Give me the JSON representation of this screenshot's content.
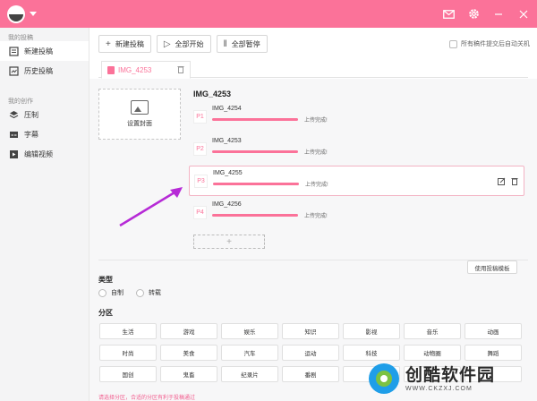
{
  "colors": {
    "accent": "#fb7299",
    "sidebar_bg": "#f4f4f5",
    "panel_bg": "#f7f7f8",
    "hint": "#f25d8e"
  },
  "titlebar": {
    "icons": [
      "app-logo",
      "mail-icon",
      "settings-icon",
      "minimize-icon",
      "close-icon"
    ]
  },
  "sidebar": {
    "group1": "我的投稿",
    "group2": "我的创作",
    "items1": [
      {
        "label": "新建投稿",
        "icon": "upload-icon",
        "active": true
      },
      {
        "label": "历史投稿",
        "icon": "history-icon",
        "active": false
      }
    ],
    "items2": [
      {
        "label": "压制",
        "icon": "layers-icon"
      },
      {
        "label": "字幕",
        "icon": "subtitle-icon"
      },
      {
        "label": "编辑视频",
        "icon": "video-edit-icon"
      }
    ]
  },
  "toolbar": {
    "new_label": "新建投稿",
    "start_all_label": "全部开始",
    "pause_all_label": "全部暂停",
    "autoshut_label": "所有稿件提交后自动关机"
  },
  "tab": {
    "name": "IMG_4253"
  },
  "cover": {
    "label": "设置封面"
  },
  "video": {
    "title": "IMG_4253"
  },
  "parts": [
    {
      "badge": "P1",
      "name": "IMG_4254",
      "status": "上传完成!",
      "progress": 1.0
    },
    {
      "badge": "P2",
      "name": "IMG_4253",
      "status": "上传完成!",
      "progress": 1.0
    },
    {
      "badge": "P3",
      "name": "IMG_4255",
      "status": "上传完成!",
      "progress": 1.0
    },
    {
      "badge": "P4",
      "name": "IMG_4256",
      "status": "上传完成!",
      "progress": 1.0
    }
  ],
  "add_part": "+",
  "template_button": "使用投稿模板",
  "type_section": {
    "title": "类型",
    "options": [
      "自制",
      "转载"
    ]
  },
  "zone_section": {
    "title": "分区",
    "items": [
      "生活",
      "游戏",
      "娱乐",
      "知识",
      "影视",
      "音乐",
      "动画",
      "时尚",
      "美食",
      "汽车",
      "运动",
      "科技",
      "动物圈",
      "舞蹈",
      "国创",
      "鬼畜",
      "纪录片",
      "番剧",
      "",
      "",
      ""
    ],
    "hint": "请选择分区，合适的分区有利于投稿通过"
  },
  "watermark": {
    "cn": "创酷软件园",
    "url": "WWW.CKZXJ.COM"
  }
}
